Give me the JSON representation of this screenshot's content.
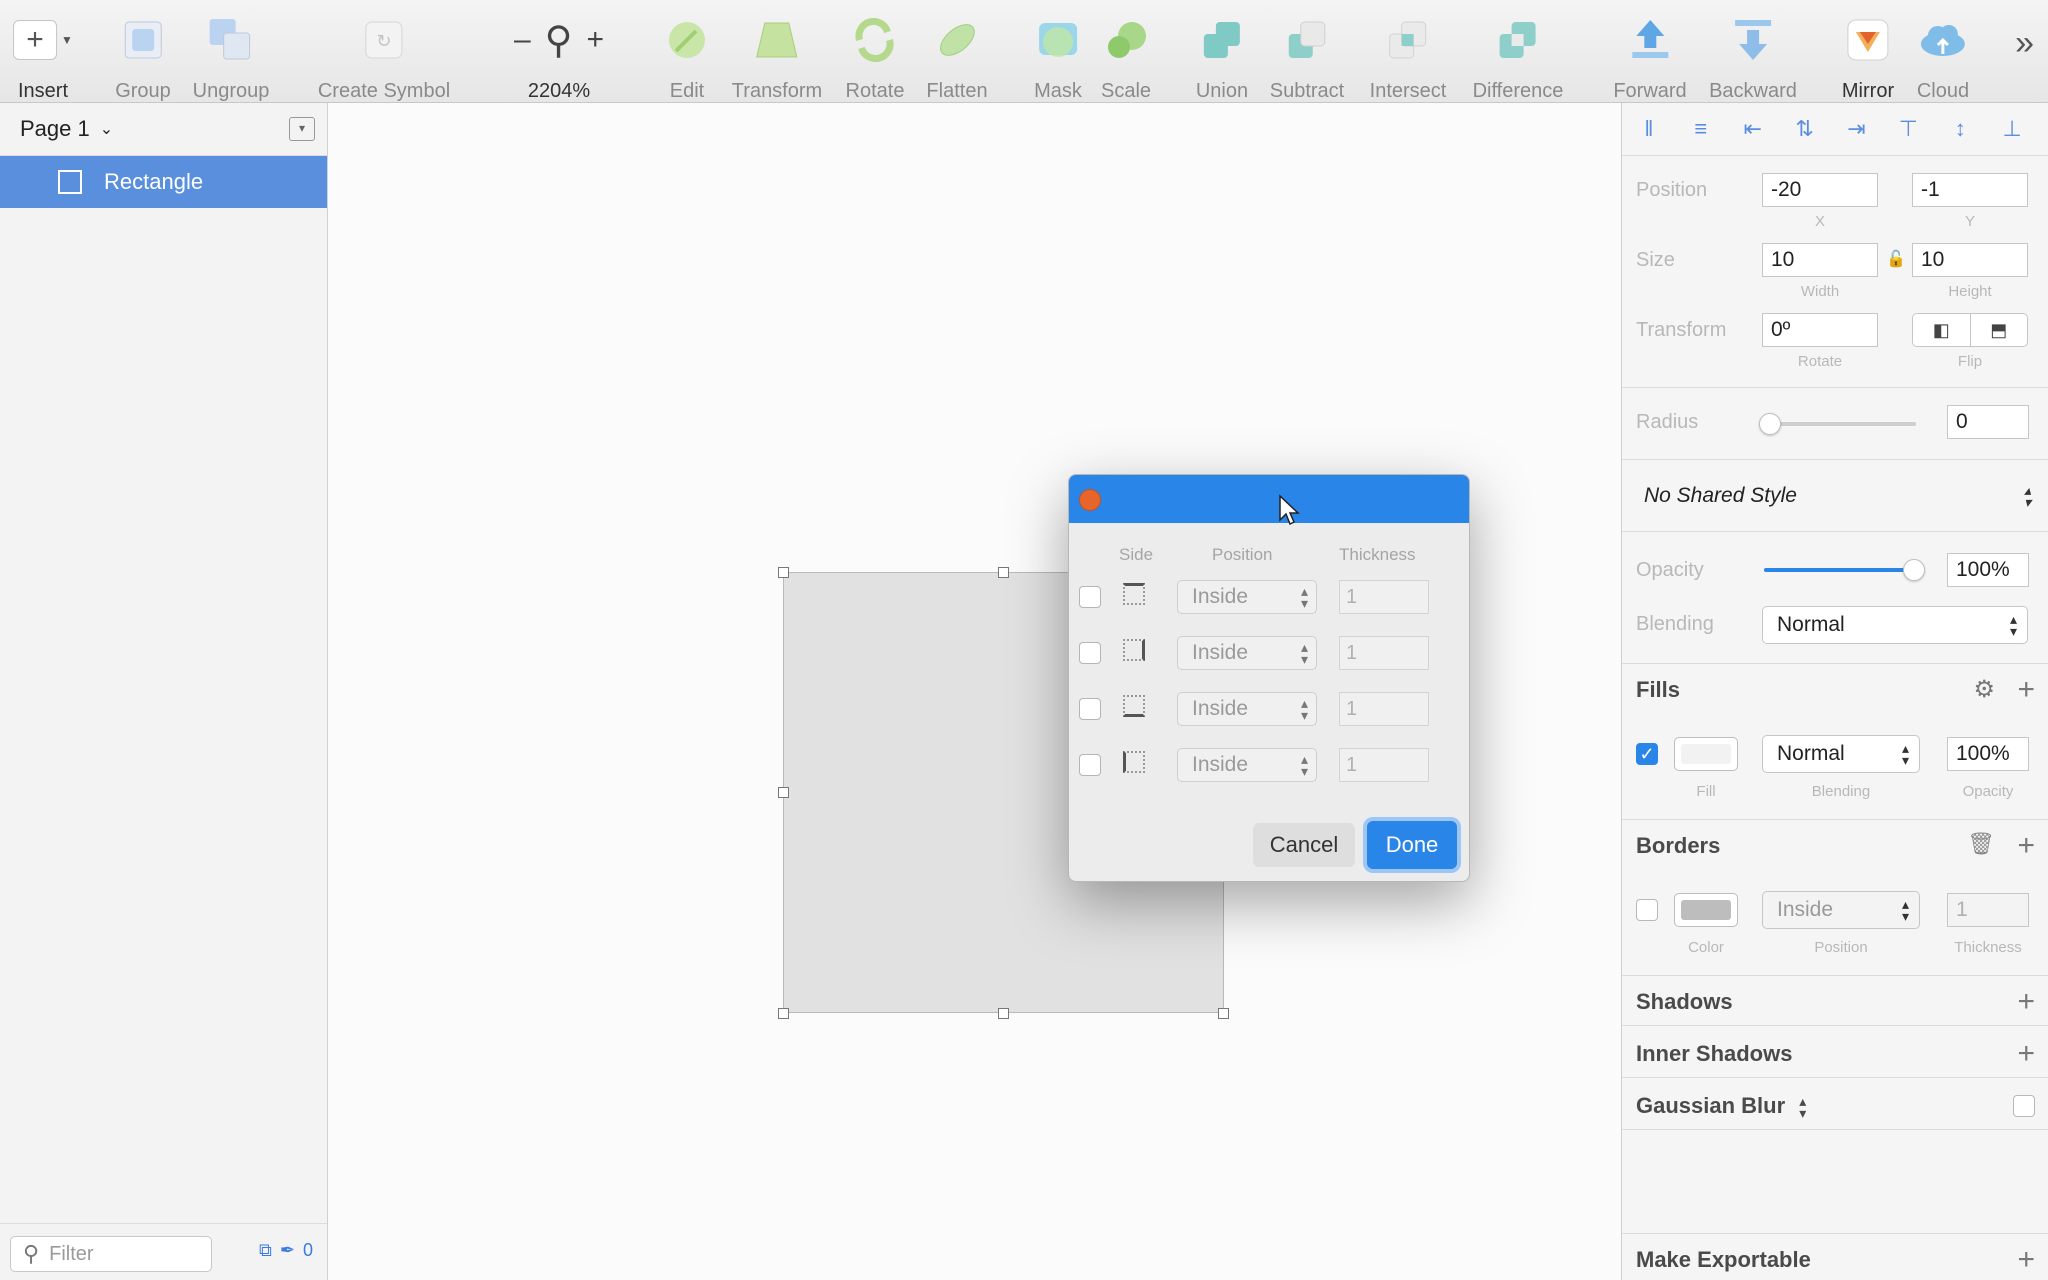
{
  "toolbar": {
    "insert": "Insert",
    "group": "Group",
    "ungroup": "Ungroup",
    "create_symbol": "Create Symbol",
    "zoom_minus": "–",
    "zoom_plus": "+",
    "zoom_level": "2204%",
    "edit": "Edit",
    "transform": "Transform",
    "rotate": "Rotate",
    "flatten": "Flatten",
    "mask": "Mask",
    "scale": "Scale",
    "union": "Union",
    "subtract": "Subtract",
    "intersect": "Intersect",
    "difference": "Difference",
    "forward": "Forward",
    "backward": "Backward",
    "mirror": "Mirror",
    "cloud": "Cloud",
    "more": "»"
  },
  "sidebar": {
    "page": "Page 1",
    "layers": [
      {
        "name": "Rectangle"
      }
    ],
    "filter_placeholder": "Filter",
    "count": "0"
  },
  "dialog": {
    "headers": {
      "side": "Side",
      "position": "Position",
      "thickness": "Thickness"
    },
    "rows": [
      {
        "position": "Inside",
        "thickness": "1"
      },
      {
        "position": "Inside",
        "thickness": "1"
      },
      {
        "position": "Inside",
        "thickness": "1"
      },
      {
        "position": "Inside",
        "thickness": "1"
      }
    ],
    "cancel": "Cancel",
    "done": "Done"
  },
  "inspector": {
    "position": {
      "label": "Position",
      "x": "-20",
      "y": "-1",
      "x_label": "X",
      "y_label": "Y"
    },
    "size": {
      "label": "Size",
      "width": "10",
      "height": "10",
      "width_label": "Width",
      "height_label": "Height"
    },
    "transform": {
      "label": "Transform",
      "rotate": "0º",
      "rotate_label": "Rotate",
      "flip_label": "Flip"
    },
    "radius": {
      "label": "Radius",
      "value": "0",
      "level": 0
    },
    "shared_style": "No Shared Style",
    "opacity": {
      "label": "Opacity",
      "value": "100%",
      "level": 1.0
    },
    "blending": {
      "label": "Blending",
      "value": "Normal"
    },
    "fills": {
      "title": "Fills",
      "enabled": true,
      "blending": "Normal",
      "opacity": "100%",
      "fill_label": "Fill",
      "blending_label": "Blending",
      "opacity_label": "Opacity",
      "color": "#f2f2f2"
    },
    "borders": {
      "title": "Borders",
      "enabled": false,
      "position": "Inside",
      "thickness": "1",
      "color_label": "Color",
      "position_label": "Position",
      "thickness_label": "Thickness",
      "color": "#bdbdbd"
    },
    "shadows": "Shadows",
    "inner_shadows": "Inner Shadows",
    "gaussian_blur": "Gaussian Blur",
    "make_exportable": "Make Exportable"
  },
  "colors": {
    "accent": "#2a85e8",
    "selection": "#5a8fde",
    "close": "#e7642a"
  }
}
